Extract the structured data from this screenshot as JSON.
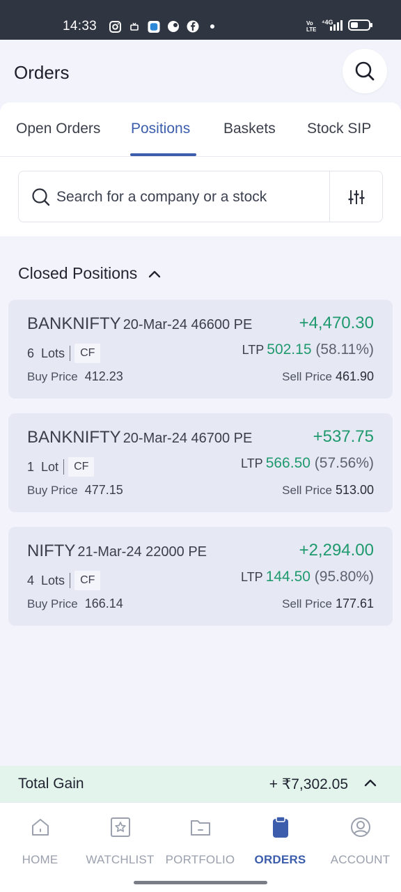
{
  "status_bar": {
    "time": "14:33",
    "network": "4G"
  },
  "header": {
    "title": "Orders"
  },
  "tabs": [
    {
      "label": "Open Orders"
    },
    {
      "label": "Positions"
    },
    {
      "label": "Baskets"
    },
    {
      "label": "Stock SIP"
    }
  ],
  "active_tab": "Positions",
  "search": {
    "placeholder": "Search for a company or a stock"
  },
  "section": {
    "title": "Closed Positions"
  },
  "positions": [
    {
      "symbol": "BANKNIFTY",
      "detail": "20-Mar-24 46600 PE",
      "pnl": "+4,470.30",
      "lots": "6",
      "lots_unit": "Lots",
      "tag": "CF",
      "ltp_label": "LTP",
      "ltp": "502.15",
      "ltp_change": "(58.11%)",
      "buy_label": "Buy Price",
      "buy_price": "412.23",
      "sell_label": "Sell Price",
      "sell_price": "461.90"
    },
    {
      "symbol": "BANKNIFTY",
      "detail": "20-Mar-24 46700 PE",
      "pnl": "+537.75",
      "lots": "1",
      "lots_unit": "Lot",
      "tag": "CF",
      "ltp_label": "LTP",
      "ltp": "566.50",
      "ltp_change": "(57.56%)",
      "buy_label": "Buy Price",
      "buy_price": "477.15",
      "sell_label": "Sell Price",
      "sell_price": "513.00"
    },
    {
      "symbol": "NIFTY",
      "detail": "21-Mar-24 22000 PE",
      "pnl": "+2,294.00",
      "lots": "4",
      "lots_unit": "Lots",
      "tag": "CF",
      "ltp_label": "LTP",
      "ltp": "144.50",
      "ltp_change": "(95.80%)",
      "buy_label": "Buy Price",
      "buy_price": "166.14",
      "sell_label": "Sell Price",
      "sell_price": "177.61"
    }
  ],
  "total_gain": {
    "label": "Total Gain",
    "value": "+ ₹7,302.05"
  },
  "bottom_nav": [
    {
      "label": "HOME",
      "icon": "home-icon"
    },
    {
      "label": "WATCHLIST",
      "icon": "star-icon"
    },
    {
      "label": "PORTFOLIO",
      "icon": "folder-icon"
    },
    {
      "label": "ORDERS",
      "icon": "clipboard-icon"
    },
    {
      "label": "ACCOUNT",
      "icon": "account-icon"
    }
  ],
  "active_nav": "ORDERS",
  "colors": {
    "accent": "#3b5dab",
    "gain": "#1f9a6e",
    "card_bg": "#e6e8f3",
    "gain_bar_bg": "#e3f4ec"
  }
}
